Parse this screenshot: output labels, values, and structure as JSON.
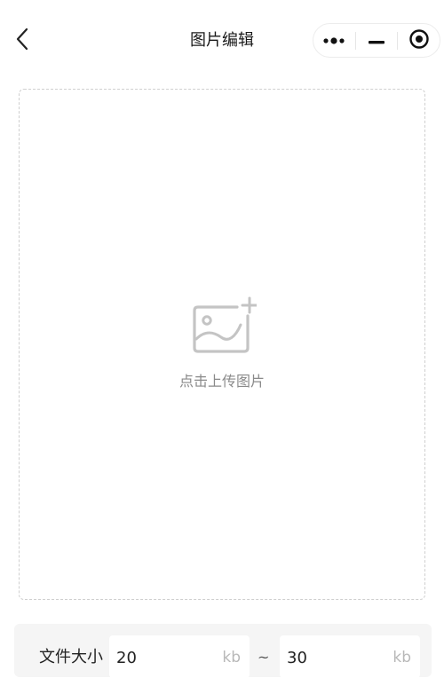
{
  "navbar": {
    "title": "图片编辑",
    "back_icon": "chevron-left-icon",
    "capsule": {
      "more_icon": "more-dots-icon",
      "minimize_icon": "minimize-icon",
      "close_icon": "target-close-icon"
    }
  },
  "upload": {
    "icon": "image-add-icon",
    "label": "点击上传图片"
  },
  "file_size": {
    "label": "文件大小",
    "min_value": "20",
    "min_unit": "kb",
    "separator": "~",
    "max_value": "30",
    "max_unit": "kb"
  },
  "colors": {
    "background": "#ffffff",
    "panel_background": "#f5f5f5",
    "dashed_border": "#cfcfcf",
    "muted_text": "#8a8a8a",
    "unit_text": "#b8b8b8"
  }
}
